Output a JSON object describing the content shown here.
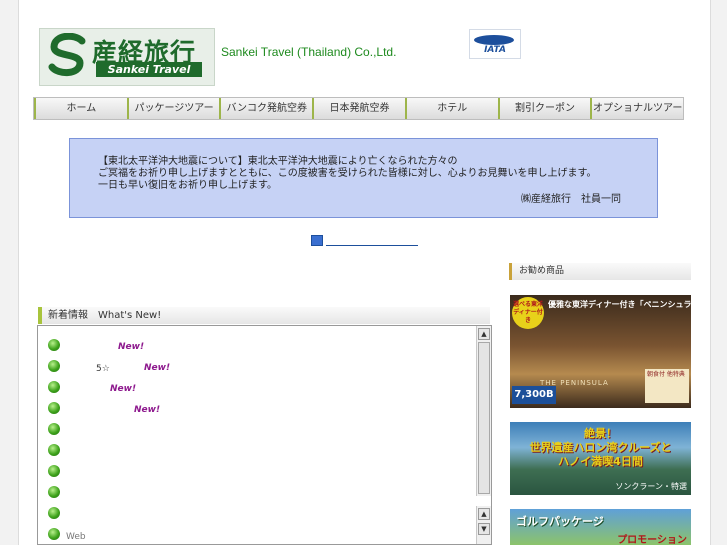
{
  "header": {
    "logo_jp": "産経旅行",
    "logo_en": "Sankei Travel",
    "company": "Sankei Travel (Thailand) Co.,Ltd.",
    "iata": "IATA"
  },
  "nav": [
    "ホーム",
    "パッケージツアー",
    "バンコク発航空券",
    "日本発航空券",
    "ホテル",
    "割引クーポン",
    "オプショナルツアー"
  ],
  "notice": {
    "line1": "【東北太平洋沖大地震について】東北太平洋沖大地震により亡くなられた方々の",
    "line2": "ご冥福をお祈り申し上げますとともに、この度被害を受けられた皆様に対し、心よりお見舞いを申し上げます。",
    "line3": "一日も早い復旧をお祈り申し上げます。",
    "sign": "㈱産経旅行　社員一同"
  },
  "whats_new": {
    "title": "新着情報　What's New!",
    "new_tag": "New!",
    "item_5_text": "5☆",
    "bottom_text": "Web"
  },
  "recommended": {
    "title": "お勧め商品",
    "product1": {
      "title": "優雅な東洋ディナー付き「ペニンシュラバンコク」",
      "badge": "選べる東洋ディナー付き",
      "price": "7,300B",
      "brand": "THE PENINSULA",
      "side": "朝食付 他特典"
    },
    "product2": {
      "title_line1": "絶景！",
      "title_line2": "世界遺産ハロン湾クルーズと",
      "title_line3": "ハノイ満喫4日間",
      "caption": "ソンクラーン・特選"
    },
    "product3": {
      "title": "ゴルフパッケージ",
      "subtitle": "プロモーション"
    }
  },
  "colors": {
    "nav_accent": "#9db54a",
    "notice_bg": "#c6d2f5",
    "company_text": "#1e8a1e",
    "new_tag": "#8e1a8e"
  }
}
